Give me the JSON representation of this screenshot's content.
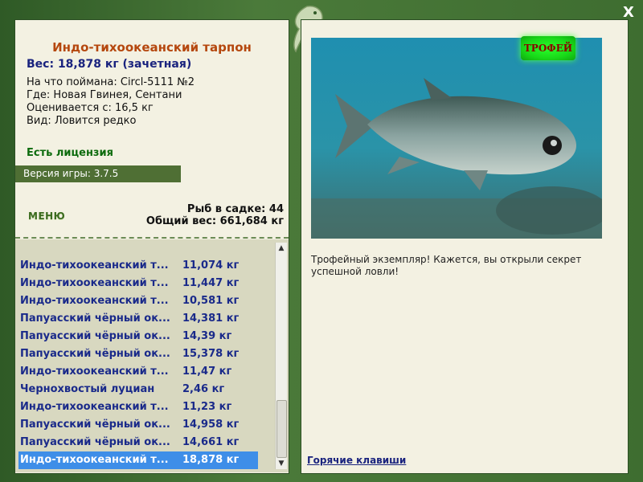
{
  "window": {
    "close_label": "X"
  },
  "fish": {
    "title": "Индо-тихоокеанский тарпон",
    "weight": "Вес: 18,878 кг (зачетная)",
    "caught_on": "На что поймана: Circl-5111 №2",
    "location": "Где: Новая Гвинея, Сентани",
    "valued_from": "Оценивается с: 16,5 кг",
    "rarity": "Вид: Ловится редко"
  },
  "license": "Есть лицензия",
  "version": "Версия игры: 3.7.5",
  "menu_label": "МЕНЮ",
  "stats": {
    "fish_count": "Рыб в садке: 44",
    "total_weight": "Общий вес: 661,684 кг"
  },
  "catch_list": [
    {
      "name": "Индо-тихоокеанский т...",
      "weight": "11,074 кг"
    },
    {
      "name": "Индо-тихоокеанский т...",
      "weight": "11,447 кг"
    },
    {
      "name": "Индо-тихоокеанский т...",
      "weight": "10,581 кг"
    },
    {
      "name": "Папуасский чёрный ок...",
      "weight": "14,381 кг"
    },
    {
      "name": "Папуасский чёрный ок...",
      "weight": "14,39 кг"
    },
    {
      "name": "Папуасский чёрный ок...",
      "weight": "15,378 кг"
    },
    {
      "name": "Индо-тихоокеанский т...",
      "weight": "11,47 кг"
    },
    {
      "name": "Чернохвостый луциан",
      "weight": "2,46 кг"
    },
    {
      "name": "Индо-тихоокеанский т...",
      "weight": "11,23 кг"
    },
    {
      "name": "Папуасский чёрный ок...",
      "weight": "14,958 кг"
    },
    {
      "name": "Папуасский чёрный ок...",
      "weight": "14,661 кг"
    },
    {
      "name": "Индо-тихоокеанский т...",
      "weight": "18,878 кг"
    }
  ],
  "selected_index": 11,
  "scrollbar": {
    "up_icon": "▲",
    "down_icon": "▼"
  },
  "trophy_badge": "ТРОФЕЙ",
  "caption": "Трофейный экземпляр! Кажется, вы открыли секрет успешной ловли!",
  "hotkeys_label": "Горячие клавиши",
  "colors": {
    "accent": "#3e8ee8",
    "frame": "#3d6a2f",
    "title": "#b5470e",
    "list_text": "#1a2a8a"
  }
}
